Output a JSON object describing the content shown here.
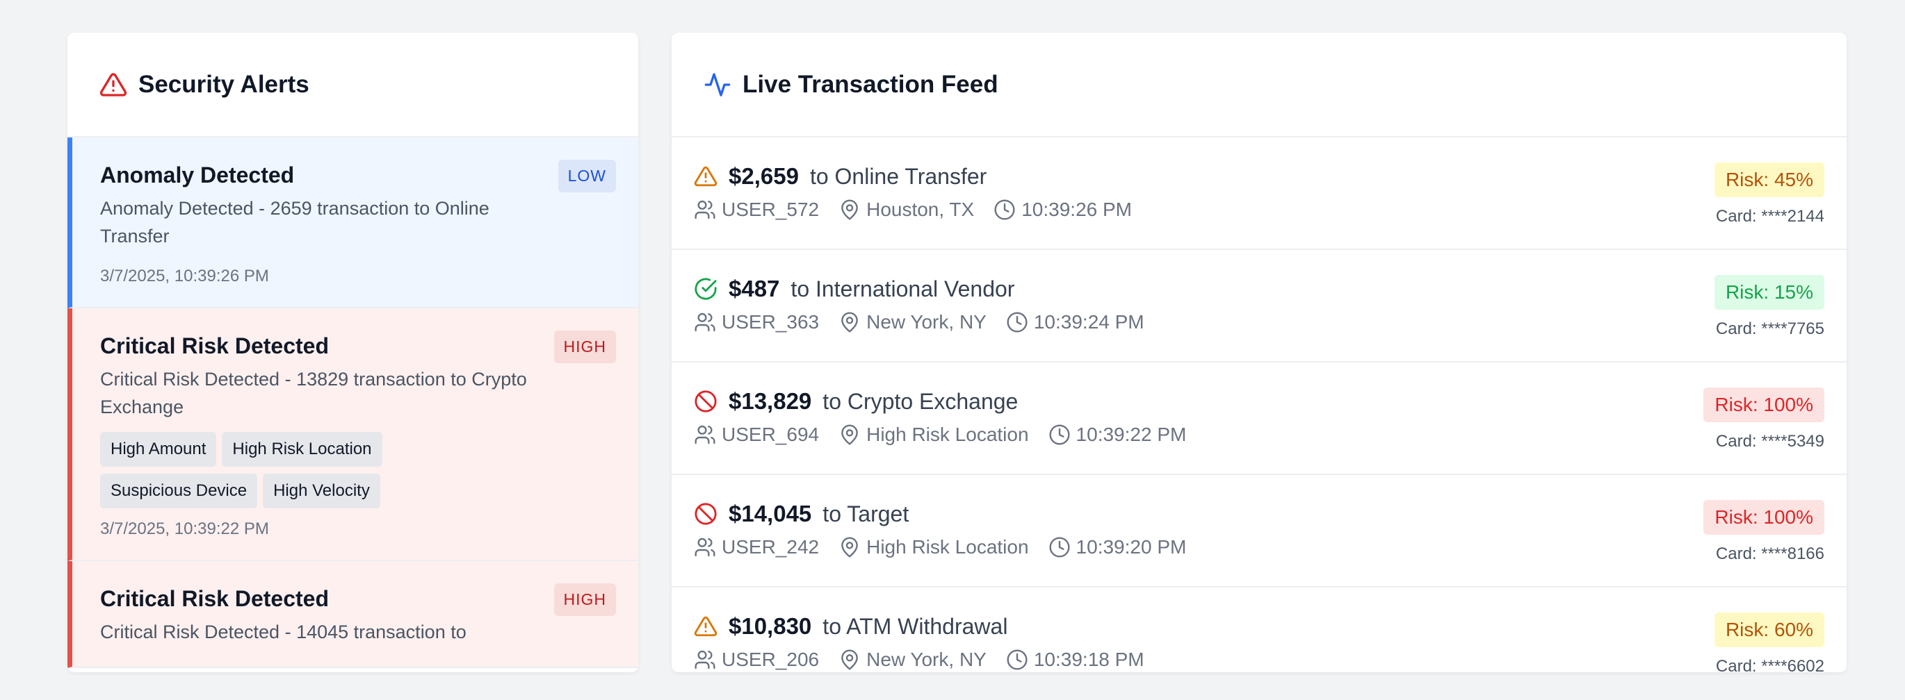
{
  "colors": {
    "alert_accent": "#dc2626",
    "feed_accent": "#2563eb",
    "low_border": "#3b82f6",
    "high_border": "#e2524a"
  },
  "alerts_panel": {
    "title": "Security Alerts",
    "icon": "warning-triangle-icon",
    "alerts": [
      {
        "title": "Anomaly Detected",
        "description": "Anomaly Detected - 2659 transaction to Online Transfer",
        "severity": "LOW",
        "tags": [],
        "time": "3/7/2025, 10:39:26 PM"
      },
      {
        "title": "Critical Risk Detected",
        "description": "Critical Risk Detected - 13829 transaction to Crypto Exchange",
        "severity": "HIGH",
        "tags": [
          "High Amount",
          "High Risk Location",
          "Suspicious Device",
          "High Velocity"
        ],
        "time": "3/7/2025, 10:39:22 PM"
      },
      {
        "title": "Critical Risk Detected",
        "description": "Critical Risk Detected - 14045 transaction to",
        "severity": "HIGH",
        "tags": [],
        "time": ""
      }
    ]
  },
  "feed_panel": {
    "title": "Live Transaction Feed",
    "icon": "activity-pulse-icon",
    "transactions": [
      {
        "status": "warning",
        "amount": "$2,659",
        "merchant": "to Online Transfer",
        "user": "USER_572",
        "location": "Houston, TX",
        "time": "10:39:26 PM",
        "risk": "Risk: 45%",
        "risk_level": "med",
        "card": "Card: ****2144"
      },
      {
        "status": "ok",
        "amount": "$487",
        "merchant": "to International Vendor",
        "user": "USER_363",
        "location": "New York, NY",
        "time": "10:39:24 PM",
        "risk": "Risk: 15%",
        "risk_level": "low",
        "card": "Card: ****7765"
      },
      {
        "status": "blocked",
        "amount": "$13,829",
        "merchant": "to Crypto Exchange",
        "user": "USER_694",
        "location": "High Risk Location",
        "time": "10:39:22 PM",
        "risk": "Risk: 100%",
        "risk_level": "high",
        "card": "Card: ****5349"
      },
      {
        "status": "blocked",
        "amount": "$14,045",
        "merchant": "to Target",
        "user": "USER_242",
        "location": "High Risk Location",
        "time": "10:39:20 PM",
        "risk": "Risk: 100%",
        "risk_level": "high",
        "card": "Card: ****8166"
      },
      {
        "status": "warning",
        "amount": "$10,830",
        "merchant": "to ATM Withdrawal",
        "user": "USER_206",
        "location": "New York, NY",
        "time": "10:39:18 PM",
        "risk": "Risk: 60%",
        "risk_level": "med",
        "card": "Card: ****6602"
      }
    ]
  }
}
